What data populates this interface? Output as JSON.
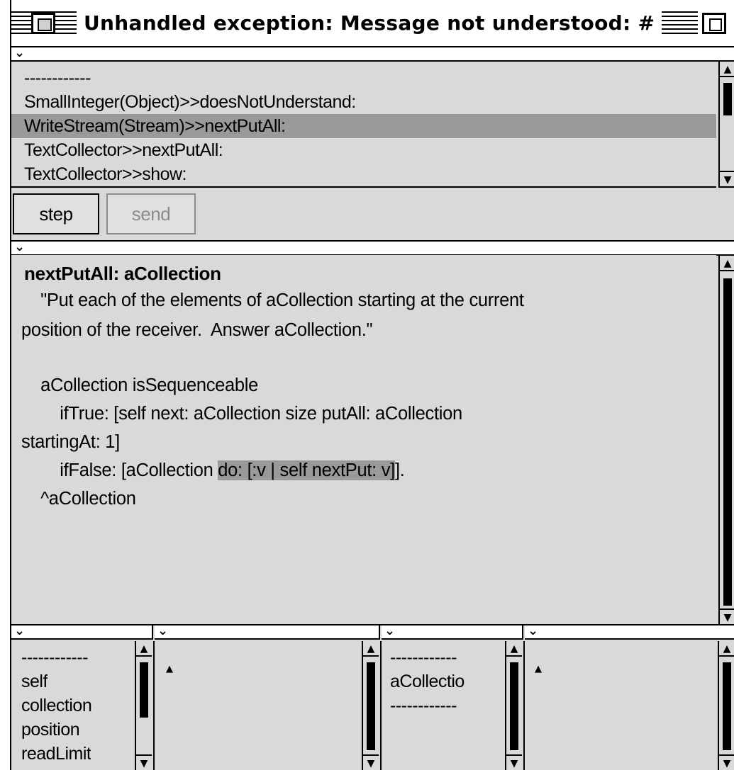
{
  "window": {
    "title": "Unhandled exception: Message not understood: #"
  },
  "stack_list": {
    "items": [
      {
        "label": "------------",
        "selected": false
      },
      {
        "label": "SmallInteger(Object)>>doesNotUnderstand:",
        "selected": false
      },
      {
        "label": "WriteStream(Stream)>>nextPutAll:",
        "selected": true
      },
      {
        "label": "TextCollector>>nextPutAll:",
        "selected": false
      },
      {
        "label": "TextCollector>>show:",
        "selected": false
      }
    ]
  },
  "buttons": {
    "step": "step",
    "send": "send"
  },
  "code": {
    "line1": "nextPutAll: aCollection",
    "line2": "\t\"Put each of the elements of aCollection starting at the current",
    "line3": "position of the receiver.  Answer aCollection.\"",
    "line4": "\taCollection isSequenceable",
    "line5": "\t\tifTrue: [self next: aCollection size putAll: aCollection",
    "line6": "startingAt: 1]",
    "line7_pre": "\t\tifFalse: [aCollection ",
    "line7_hl": "do: [:v | self nextPut: v]",
    "line7_post": "].",
    "line8": "\t^aCollection"
  },
  "receiver_inspector": {
    "fields": [
      "------------",
      "self",
      "collection",
      "position",
      "readLimit"
    ]
  },
  "context_inspector": {
    "fields": [
      "------------",
      "aCollectio",
      "------------"
    ]
  },
  "icons": {
    "chevron": "⌄",
    "up_arrow": "▲",
    "down_arrow": "▼"
  }
}
